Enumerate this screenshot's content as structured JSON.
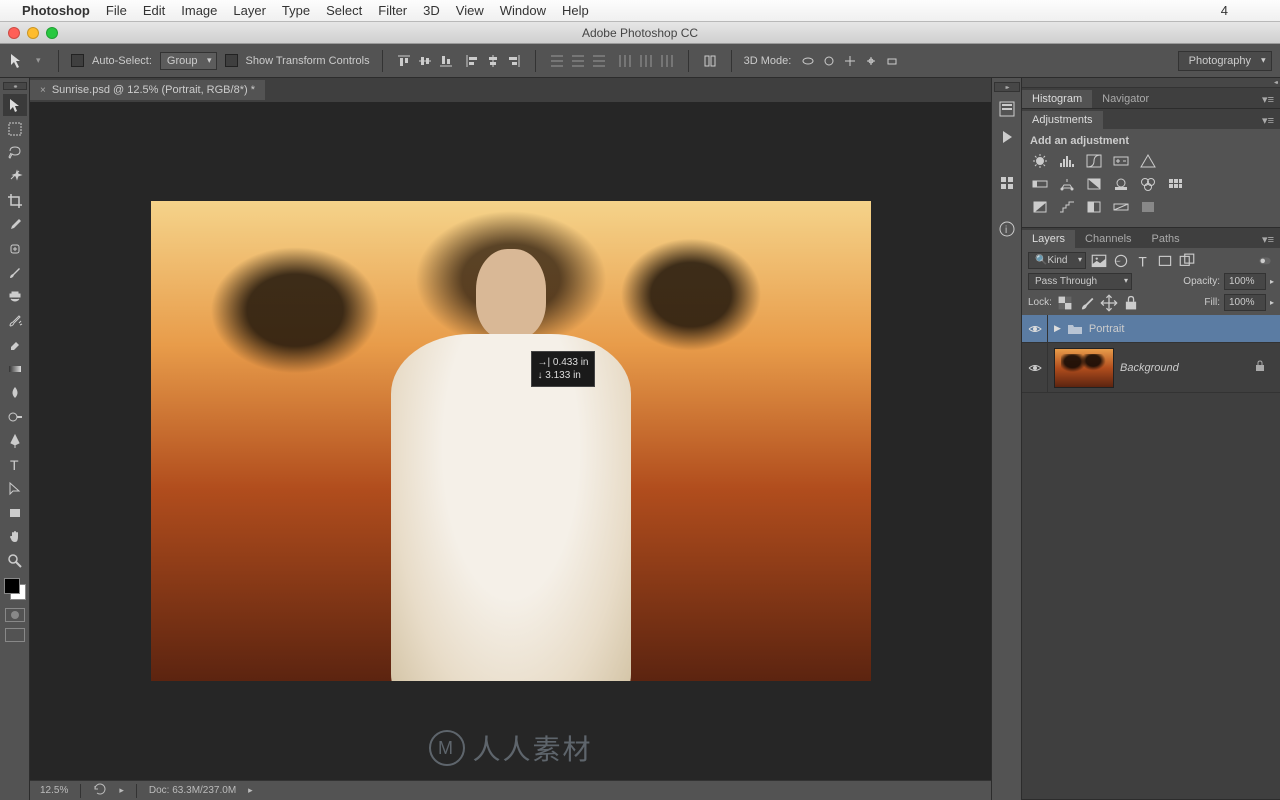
{
  "macos_menu": {
    "app": "Photoshop",
    "items": [
      "File",
      "Edit",
      "Image",
      "Layer",
      "Type",
      "Select",
      "Filter",
      "3D",
      "View",
      "Window",
      "Help"
    ],
    "right_badge": "4"
  },
  "window": {
    "title": "Adobe Photoshop CC"
  },
  "options_bar": {
    "auto_select": "Auto-Select:",
    "auto_select_mode": "Group",
    "show_transform": "Show Transform Controls",
    "mode_3d": "3D Mode:",
    "workspace": "Photography"
  },
  "document": {
    "tab": "Sunrise.psd @ 12.5% (Portrait, RGB/8*) *",
    "tooltip_x": "0.433 in",
    "tooltip_y": "3.133 in",
    "status_zoom": "12.5%",
    "status_doc": "Doc: 63.3M/237.0M"
  },
  "panels": {
    "histogram_tab": "Histogram",
    "navigator_tab": "Navigator",
    "adjustments_tab": "Adjustments",
    "adjustments_title": "Add an adjustment",
    "layers_tab": "Layers",
    "channels_tab": "Channels",
    "paths_tab": "Paths"
  },
  "layers": {
    "filter_kind": "Kind",
    "blend_mode": "Pass Through",
    "opacity_label": "Opacity:",
    "opacity": "100%",
    "lock_label": "Lock:",
    "fill_label": "Fill:",
    "fill": "100%",
    "items": [
      {
        "name": "Portrait",
        "type": "group"
      },
      {
        "name": "Background",
        "type": "bg"
      }
    ]
  }
}
